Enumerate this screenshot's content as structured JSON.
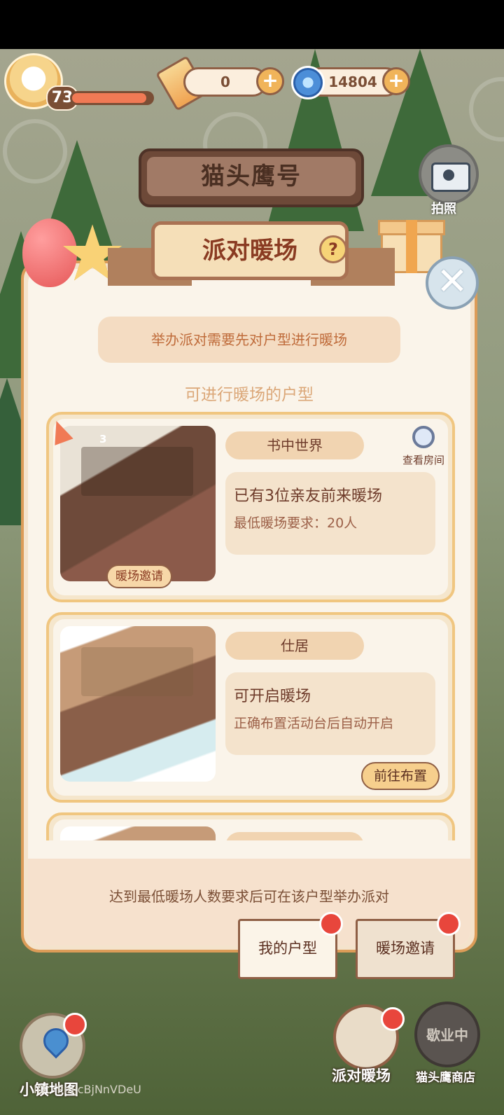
{
  "hud": {
    "level": "73",
    "xp_fraction": 0.93,
    "ticket_count": "0",
    "coin_count": "14804",
    "plus_label": "+"
  },
  "location_sign": "猫头鹰号",
  "camera_label": "拍照",
  "dialog": {
    "title": "派对暖场",
    "help_label": "?",
    "close_label": "✕",
    "notice": "举办派对需要先对户型进行暖场",
    "section_title": "可进行暖场的户型",
    "cards": [
      {
        "name": "书中世界",
        "badge_count": "3",
        "view_room_label": "查看房间",
        "status": "已有3位亲友前来暖场",
        "detail": "最低暖场要求：20人",
        "action_label": "暖场邀请"
      },
      {
        "name": "仕居",
        "status": "可开启暖场",
        "detail": "正确布置活动台后自动开启",
        "action_label": "前往布置"
      },
      {
        "name": ""
      }
    ],
    "footer_text": "达到最低暖场人数要求后可在该户型举办派对",
    "tabs": [
      "我的户型",
      "暖场邀请"
    ]
  },
  "bottom_hud": {
    "map_label": "小镇地图",
    "party_label": "派对暖场",
    "shop_label": "猫头鹰商店",
    "shop_status": "歇业中",
    "user_id": "ID：PmjcBjNnVDeU"
  },
  "colors": {
    "accent": "#dc9c58",
    "title_text": "#8a3b22",
    "notification_dot": "#e8463c"
  }
}
